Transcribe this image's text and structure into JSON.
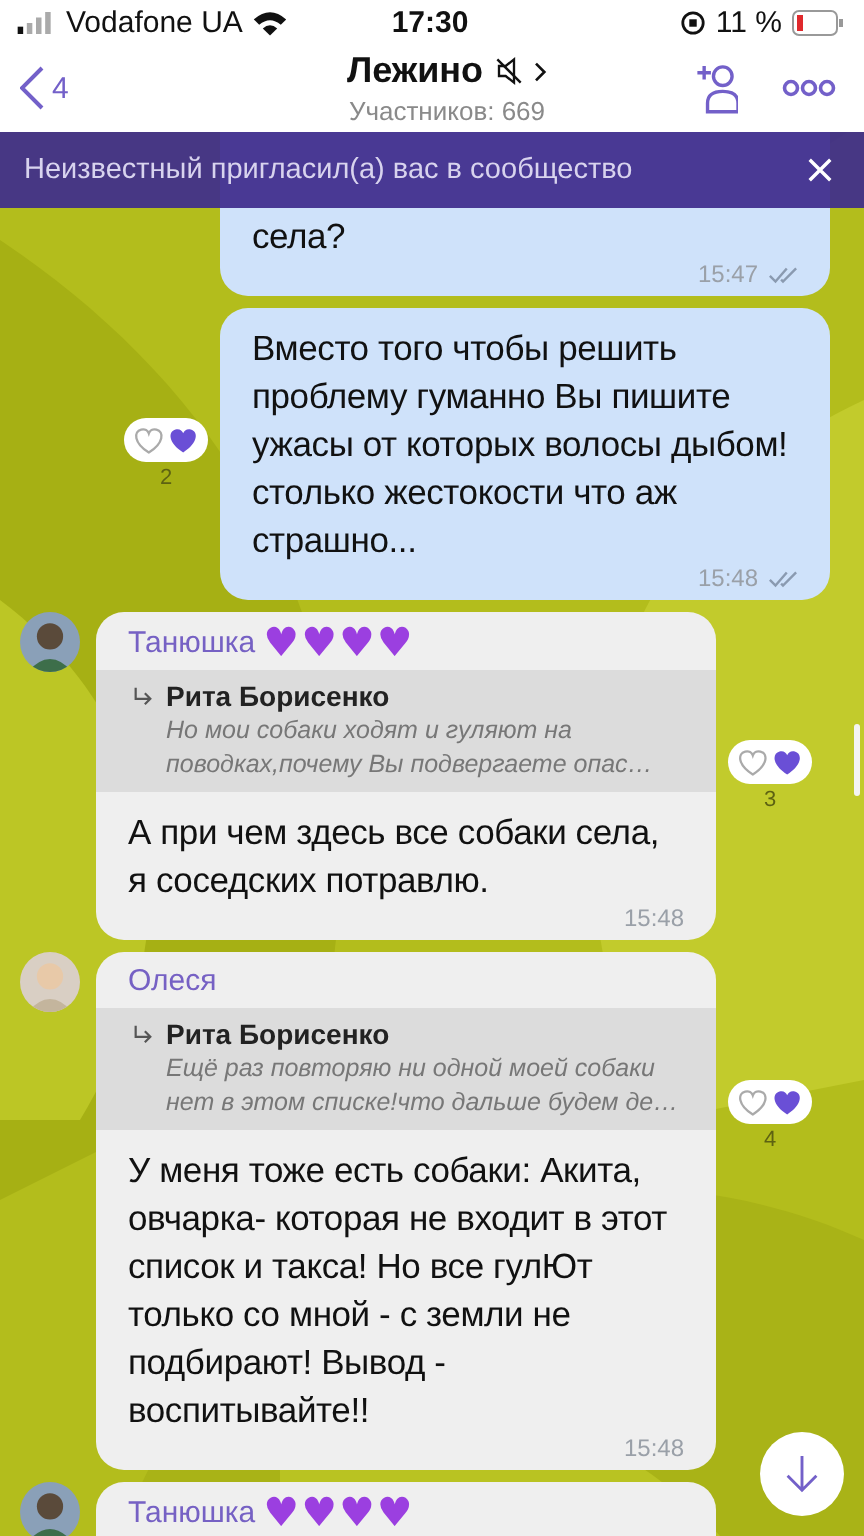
{
  "status_bar": {
    "carrier": "Vodafone UA",
    "time": "17:30",
    "battery": "11 %"
  },
  "header": {
    "back_count": "4",
    "title": "Лежино",
    "subtitle": "Участников: 669"
  },
  "banner": {
    "text": "Неизвестный пригласил(а) вас в сообщество"
  },
  "messages": [
    {
      "kind": "outgoing",
      "text": "села?",
      "time": "15:47",
      "read": true,
      "clipped": true
    },
    {
      "kind": "outgoing",
      "text": "Вместо того чтобы решить проблему гуманно Вы пишите ужасы от которых волосы дыбом! столько жестокости что аж страшно...",
      "time": "15:48",
      "read": true,
      "reactions": "2"
    },
    {
      "kind": "incoming",
      "sender": "Танюшка",
      "badge": "♥♥♥♥",
      "reply": {
        "author": "Рита Борисенко",
        "text": "Но мои собаки ходят и гуляют на поводках,почему Вы подвергаете опас…"
      },
      "text": "А при чем здесь все собаки села, я соседских потравлю.",
      "time": "15:48",
      "reactions": "3"
    },
    {
      "kind": "incoming",
      "sender": "Олеся",
      "reply": {
        "author": "Рита Борисенко",
        "text": "Ещё раз повторяю ни одной моей собаки нет в этом списке!что дальше будем де…"
      },
      "text": "У меня тоже есть собаки: Акита, овчарка- которая не входит в этот список и такса! Но все гулЮт только со мной - с земли не подбирают! Вывод - воспитывайте!!",
      "time": "15:48",
      "reactions": "4"
    },
    {
      "kind": "incoming",
      "sender": "Танюшка",
      "badge": "♥♥♥♥"
    }
  ]
}
